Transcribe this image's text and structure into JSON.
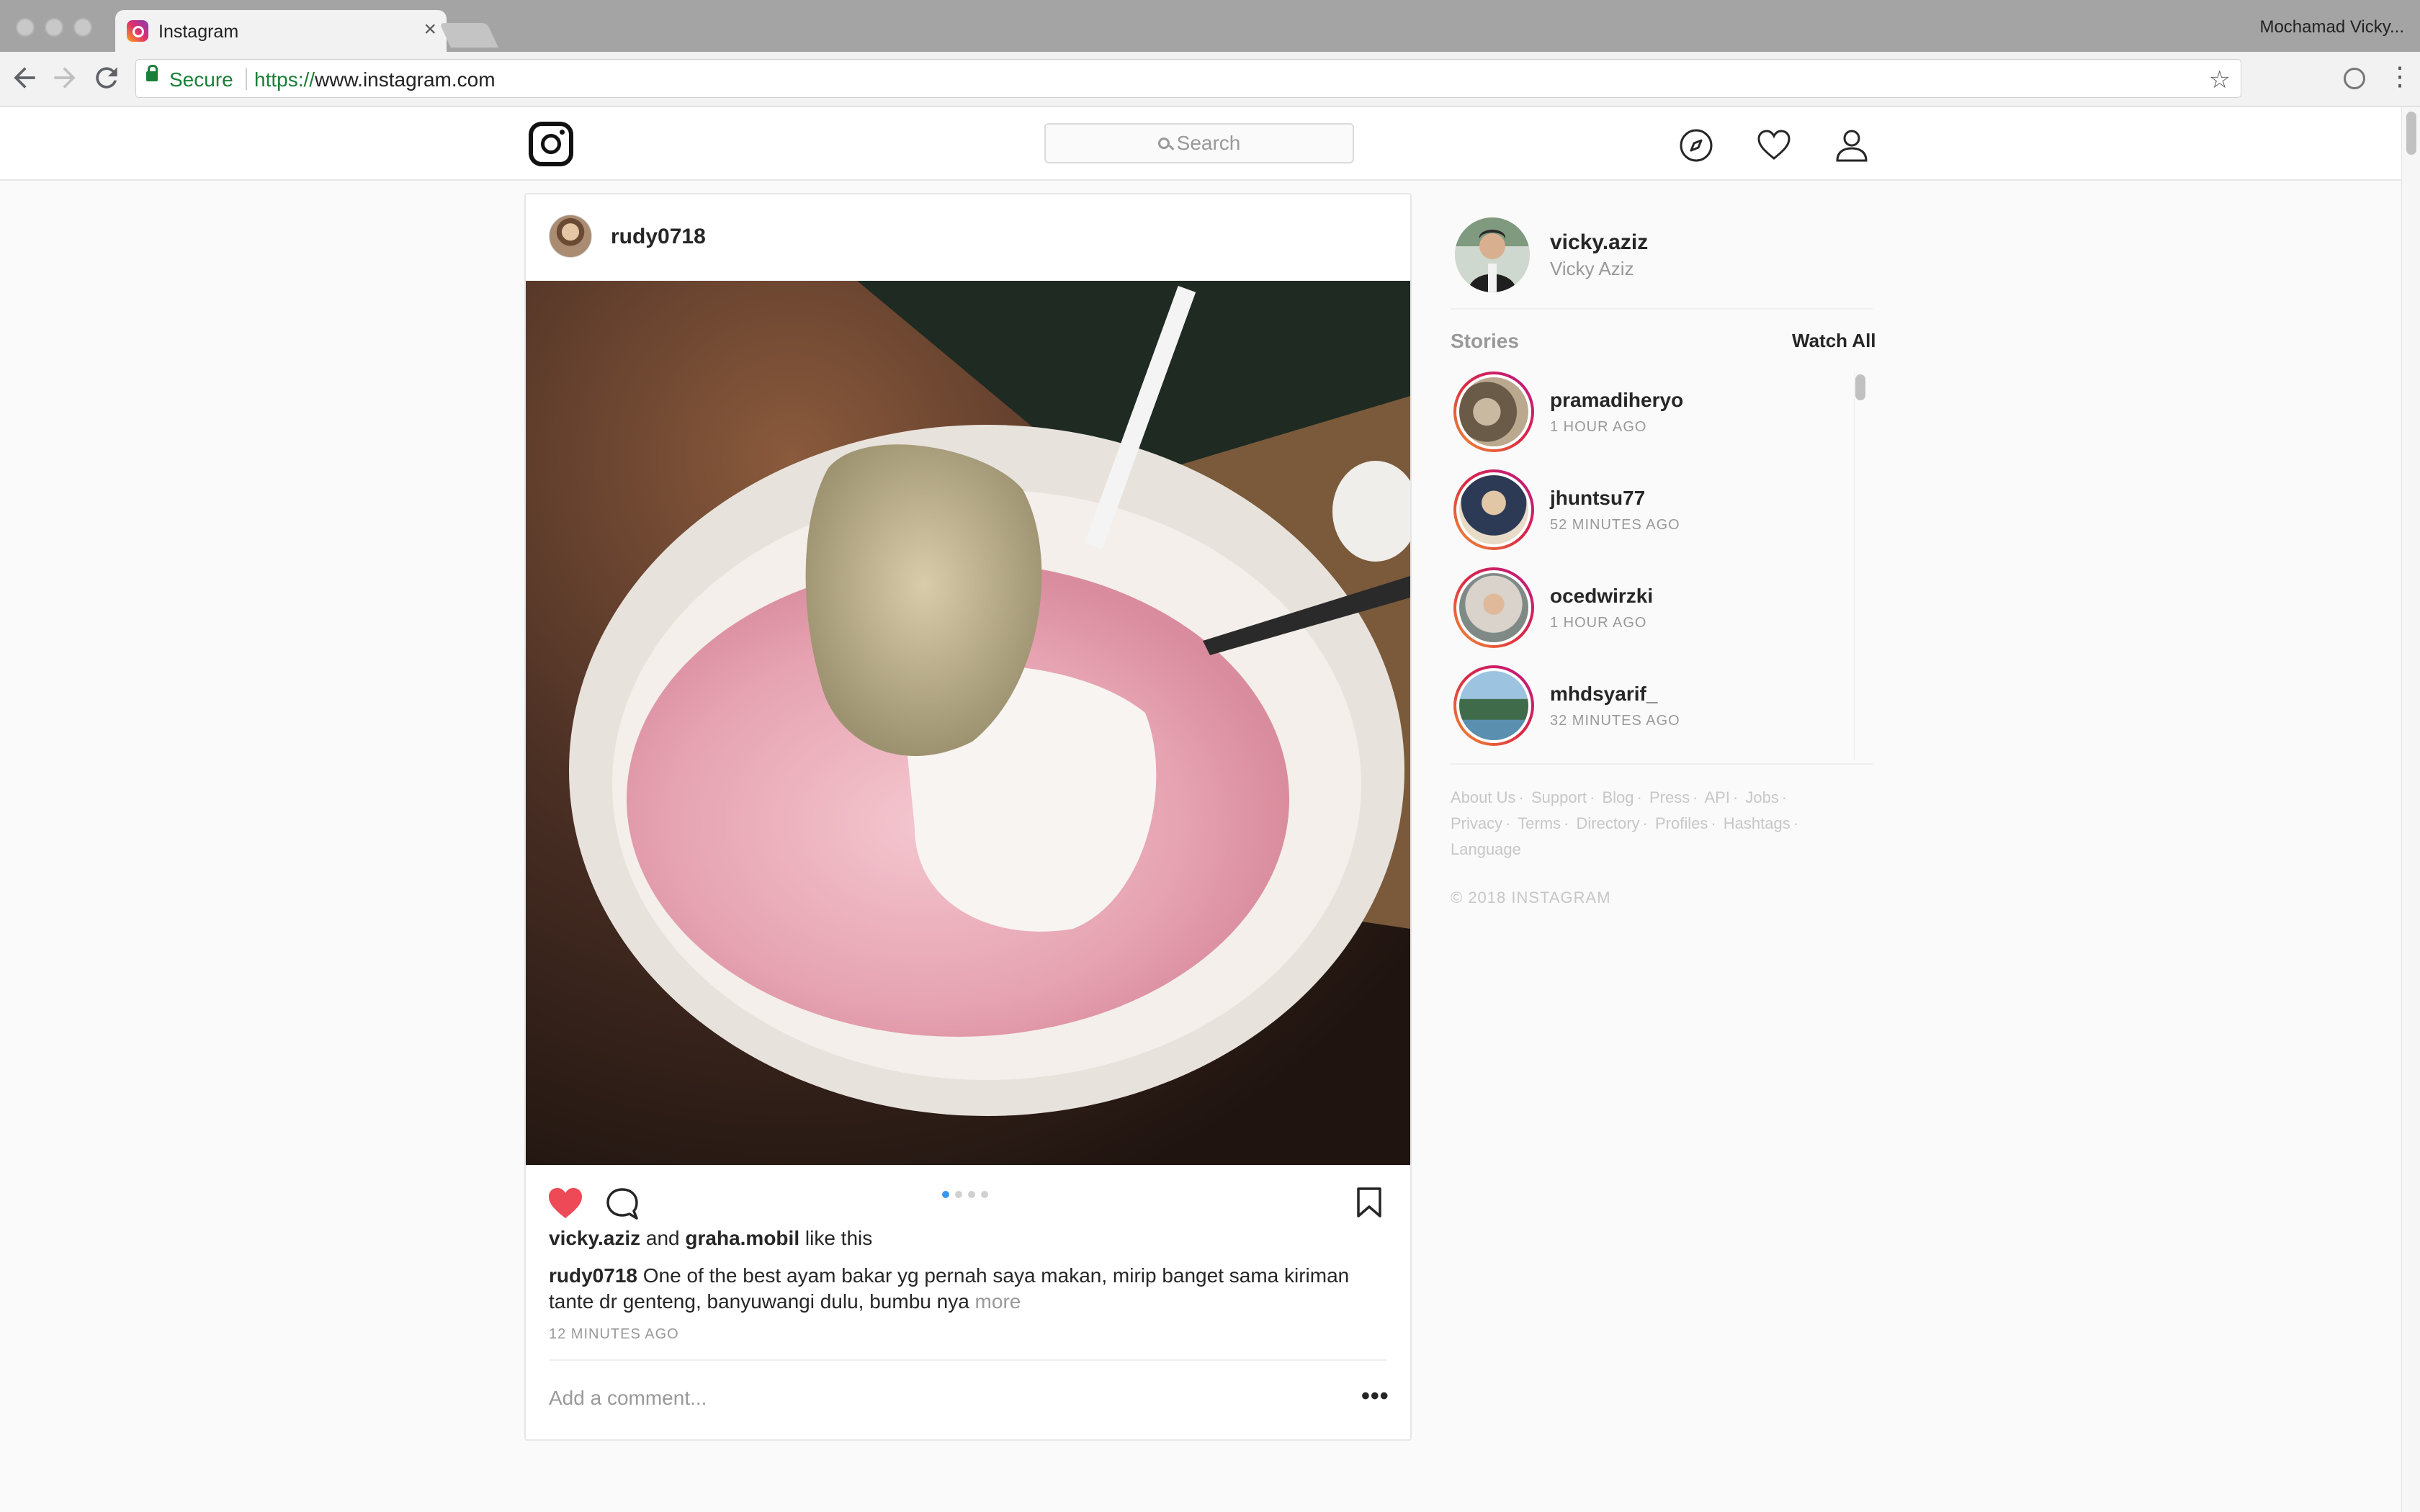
{
  "browser": {
    "tab_title": "Instagram",
    "tab_close": "×",
    "profile_name": "Mochamad Vicky...",
    "secure_label": "Secure",
    "url_scheme": "https://",
    "url_rest": "www.instagram.com",
    "icons": [
      "back-arrow-icon",
      "forward-arrow-icon",
      "reload-icon",
      "lock-icon",
      "star-icon",
      "extension-icon",
      "menu-dots-icon"
    ]
  },
  "header": {
    "search_placeholder": "Search",
    "icons": [
      "instagram-logo-icon",
      "search-icon",
      "explore-compass-icon",
      "heart-activity-icon",
      "profile-person-icon"
    ]
  },
  "post": {
    "username": "rudy0718",
    "image_description_colors": [
      "#3a2a22",
      "#e9b7c1",
      "#b9a98a",
      "#f5f3f1"
    ],
    "carousel": {
      "count": 4,
      "active_index": 0
    },
    "liked": true,
    "likes": {
      "user1": "vicky.aziz",
      "and": "and",
      "user2": "graha.mobil",
      "suffix": "like this"
    },
    "caption": {
      "username": "rudy0718",
      "text": "One of the best ayam bakar yg pernah saya makan, mirip banget sama kiriman tante dr genteng, banyuwangi dulu, bumbu nya",
      "more": "more"
    },
    "timestamp": "12 MINUTES AGO",
    "comment_placeholder": "Add a comment...",
    "more_options": "•••"
  },
  "sidebar": {
    "me": {
      "username": "vicky.aziz",
      "full_name": "Vicky Aziz"
    },
    "stories_label": "Stories",
    "watch_all": "Watch All",
    "stories": [
      {
        "username": "pramadiheryo",
        "time": "1 HOUR AGO"
      },
      {
        "username": "jhuntsu77",
        "time": "52 MINUTES AGO"
      },
      {
        "username": "ocedwirzki",
        "time": "1 HOUR AGO"
      },
      {
        "username": "mhdsyarif_",
        "time": "32 MINUTES AGO"
      }
    ],
    "footer_links": [
      "About Us",
      "Support",
      "Blog",
      "Press",
      "API",
      "Jobs",
      "Privacy",
      "Terms",
      "Directory",
      "Profiles",
      "Hashtags",
      "Language"
    ],
    "copyright": "© 2018 INSTAGRAM"
  },
  "colors": {
    "accent_blue": "#3897f0",
    "like_red": "#ed4956",
    "secure_green": "#1a7f37",
    "muted_text": "#999999"
  }
}
